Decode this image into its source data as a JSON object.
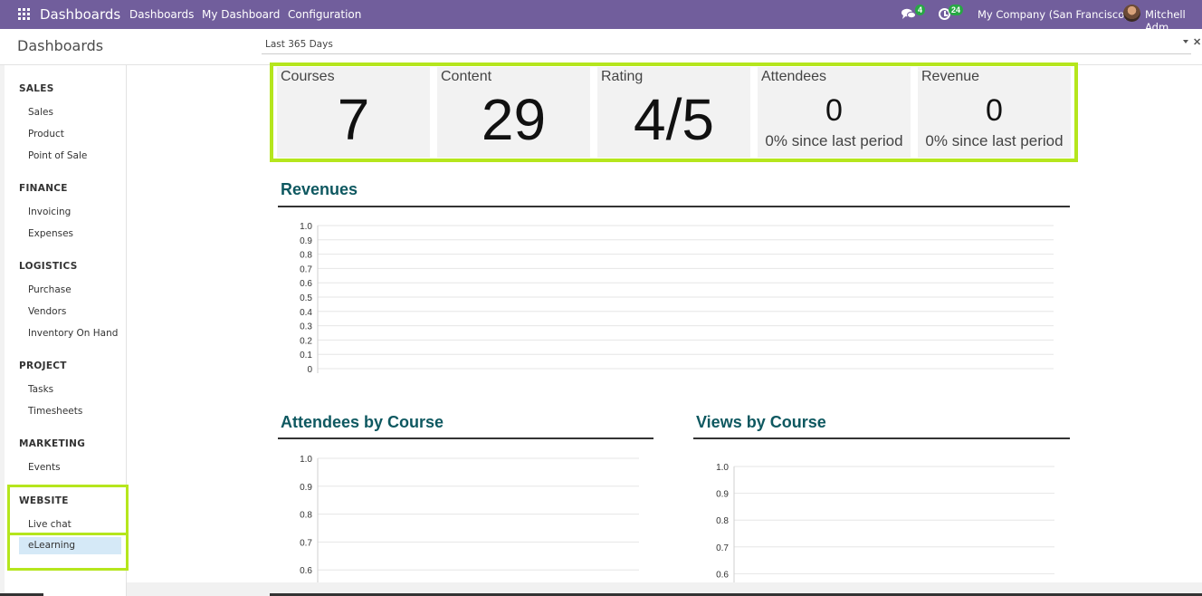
{
  "navbar": {
    "brand": "Dashboards",
    "menus": [
      "Dashboards",
      "My Dashboard",
      "Configuration"
    ],
    "messages_count": "4",
    "activities_count": "24",
    "company": "My Company (San Francisco)",
    "user": "Mitchell Adm"
  },
  "control_panel": {
    "title": "Dashboards",
    "filter": "Last 365 Days"
  },
  "sidebar": {
    "sections": [
      {
        "title": "SALES",
        "items": [
          "Sales",
          "Product",
          "Point of Sale"
        ]
      },
      {
        "title": "FINANCE",
        "items": [
          "Invoicing",
          "Expenses"
        ]
      },
      {
        "title": "LOGISTICS",
        "items": [
          "Purchase",
          "Vendors",
          "Inventory On Hand"
        ]
      },
      {
        "title": "PROJECT",
        "items": [
          "Tasks",
          "Timesheets"
        ]
      },
      {
        "title": "MARKETING",
        "items": [
          "Events"
        ]
      },
      {
        "title": "WEBSITE",
        "items": [
          "Live chat",
          "eLearning"
        ]
      }
    ],
    "active_item": "eLearning"
  },
  "kpis": [
    {
      "title": "Courses",
      "value": "7"
    },
    {
      "title": "Content",
      "value": "29"
    },
    {
      "title": "Rating",
      "value": "4/5"
    },
    {
      "title": "Attendees",
      "value": "0",
      "sub": "0% since last period"
    },
    {
      "title": "Revenue",
      "value": "0",
      "sub": "0% since last period"
    }
  ],
  "colors": {
    "navbar": "#715e9c",
    "highlight": "#b5e61d",
    "chart_title": "#0e5860",
    "active_item_bg": "#d5e9f7"
  },
  "chart_data": [
    {
      "type": "line",
      "title": "Revenues",
      "xlabel": "",
      "ylabel": "",
      "ylim": [
        0,
        1
      ],
      "yticks": [
        "1.0",
        "0.9",
        "0.8",
        "0.7",
        "0.6",
        "0.5",
        "0.4",
        "0.3",
        "0.2",
        "0.1",
        "0"
      ],
      "series": []
    },
    {
      "type": "bar",
      "title": "Attendees by Course",
      "ylim": [
        0.6,
        1.0
      ],
      "yticks": [
        "1.0",
        "0.9",
        "0.8",
        "0.7",
        "0.6"
      ],
      "series": []
    },
    {
      "type": "bar",
      "title": "Views by Course",
      "ylim": [
        0.6,
        1.0
      ],
      "yticks": [
        "1.0",
        "0.9",
        "0.8",
        "0.7",
        "0.6"
      ],
      "series": []
    }
  ]
}
